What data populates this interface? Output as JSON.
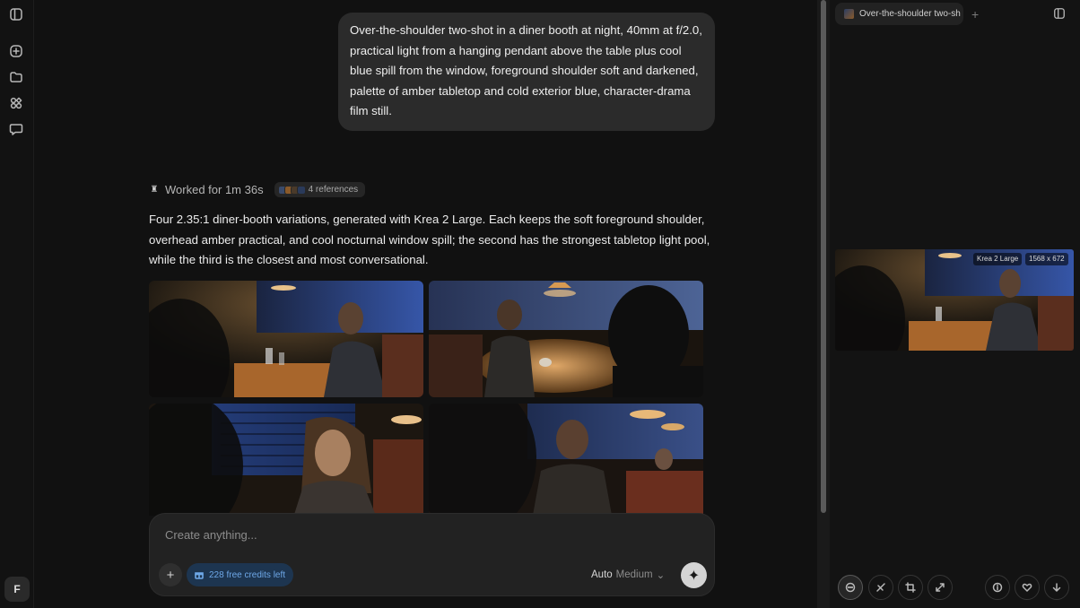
{
  "rail": {
    "icons": [
      "sidebar-toggle-icon",
      "new-chat-icon",
      "folder-icon",
      "apps-icon",
      "chat-bubble-icon"
    ],
    "avatar_initial": "F"
  },
  "chat": {
    "user_message": "Over-the-shoulder two-shot in a diner booth at night, 40mm at f/2.0, practical light from a hanging pendant above the table plus cool blue spill from the window, foreground shoulder soft and darkened, palette of amber tabletop and cold exterior blue, character-drama film still.",
    "worked_for": "Worked for 1m 36s",
    "references_label": "4 references",
    "assistant_reply": "Four 2.35:1 diner-booth variations, generated with Krea 2 Large. Each keeps the soft foreground shoulder, overhead amber practical, and cool nocturnal window spill; the second has the strongest tabletop light pool, while the third is the closest and most conversational."
  },
  "composer": {
    "placeholder": "Create anything...",
    "credits_label": "228 free credits left",
    "quality_auto": "Auto",
    "quality_level": "Medium"
  },
  "panel": {
    "tab_title": "Over-the-shoulder two-sh",
    "model_badge": "Krea 2 Large",
    "size_badge": "1568 x 672",
    "tools": [
      "chat-icon",
      "brush-icon",
      "crop-icon",
      "expand-icon",
      "info-icon",
      "heart-icon",
      "download-icon"
    ]
  },
  "colors": {
    "background": "#111111",
    "bubble": "#2b2b2b",
    "credits_bg": "#1d3550",
    "credits_text": "#6ea8e8",
    "amber": "#c8873a",
    "window_blue": "#2d4a8a"
  }
}
